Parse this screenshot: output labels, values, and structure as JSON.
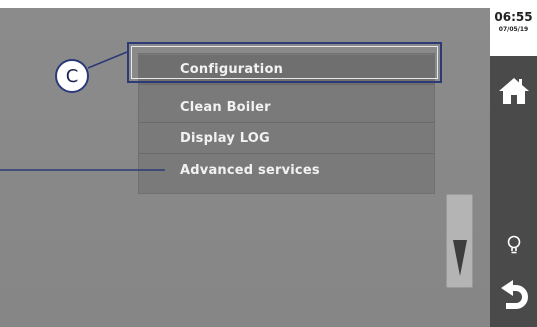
{
  "menu": {
    "items": [
      {
        "label": "Configuration"
      },
      {
        "label": "Clean Boiler"
      },
      {
        "label": "Display LOG"
      },
      {
        "label": "Advanced services"
      }
    ]
  },
  "clock": {
    "time": "06:55",
    "date": "07/05/19"
  },
  "sidebar": {
    "icons": [
      "home-icon",
      "lightbulb-icon",
      "back-arrow-icon"
    ]
  },
  "callout": {
    "label": "C",
    "color": "#2c3a78"
  },
  "scroll": {
    "icon": "scroll-down-arrow-icon"
  }
}
